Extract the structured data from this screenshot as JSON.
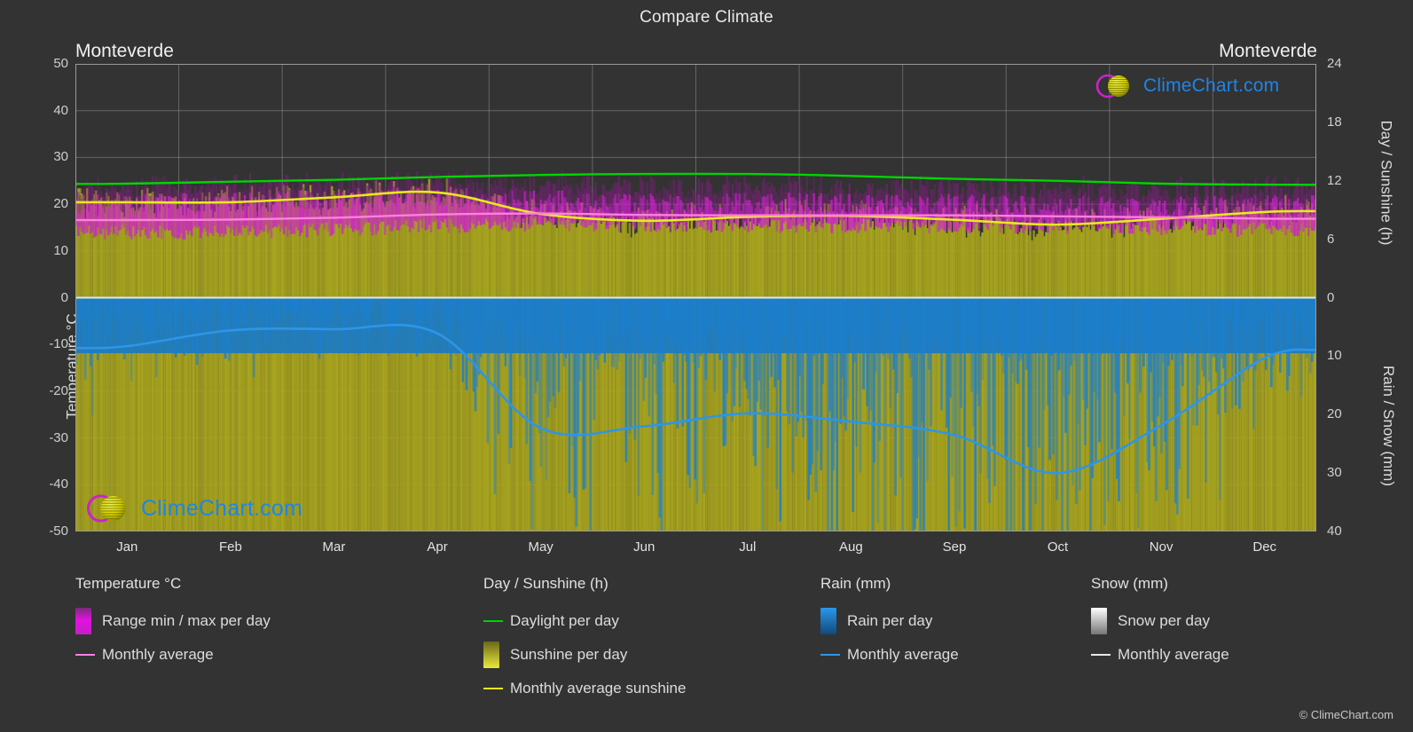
{
  "title": "Compare Climate",
  "location_left": "Monteverde",
  "location_right": "Monteverde",
  "copyright": "© ClimeChart.com",
  "logo": {
    "text": "ClimeChart.com",
    "arc_color": "#cc22cc",
    "sphere_color": "#d4d400",
    "text_color": "#1d86e8"
  },
  "axes": {
    "left_label": "Temperature °C",
    "right_top_label": "Day / Sunshine (h)",
    "right_bottom_label": "Rain / Snow (mm)",
    "left_ticks": [
      "50",
      "40",
      "30",
      "20",
      "10",
      "0",
      "-10",
      "-20",
      "-30",
      "-40",
      "-50"
    ],
    "right_top_ticks": [
      "24",
      "18",
      "12",
      "6",
      "0"
    ],
    "right_bottom_ticks": [
      "0",
      "10",
      "20",
      "30",
      "40"
    ],
    "months": [
      "Jan",
      "Feb",
      "Mar",
      "Apr",
      "May",
      "Jun",
      "Jul",
      "Aug",
      "Sep",
      "Oct",
      "Nov",
      "Dec"
    ]
  },
  "legend": {
    "temperature": {
      "heading": "Temperature °C",
      "items": [
        {
          "label": "Range min / max per day",
          "type": "swatch",
          "color": "#ff00e0"
        },
        {
          "label": "Monthly average",
          "type": "line",
          "color": "#ff7fe0"
        }
      ]
    },
    "sunshine": {
      "heading": "Day / Sunshine (h)",
      "items": [
        {
          "label": "Daylight per day",
          "type": "line",
          "color": "#00d400"
        },
        {
          "label": "Sunshine per day",
          "type": "swatch",
          "color": "#e8e840"
        },
        {
          "label": "Monthly average sunshine",
          "type": "line",
          "color": "#e8e820"
        }
      ]
    },
    "rain": {
      "heading": "Rain (mm)",
      "items": [
        {
          "label": "Rain per day",
          "type": "swatch",
          "color": "#1787e0"
        },
        {
          "label": "Monthly average",
          "type": "line",
          "color": "#2e95e8"
        }
      ]
    },
    "snow": {
      "heading": "Snow (mm)",
      "items": [
        {
          "label": "Snow per day",
          "type": "swatch",
          "color": "#f2f2f2"
        },
        {
          "label": "Monthly average",
          "type": "line",
          "color": "#e8e8e8"
        }
      ]
    }
  },
  "chart_data": {
    "type": "line",
    "title": "Compare Climate",
    "subtitle": "Monteverde",
    "xlabel": "",
    "ylabel": "Temperature °C",
    "y2label_top": "Day / Sunshine (h)",
    "y2label_bottom": "Rain / Snow (mm)",
    "grid": true,
    "legend_position": "bottom",
    "x": [
      "Jan",
      "Feb",
      "Mar",
      "Apr",
      "May",
      "Jun",
      "Jul",
      "Aug",
      "Sep",
      "Oct",
      "Nov",
      "Dec"
    ],
    "ylim_temperature": [
      -50,
      50
    ],
    "ylim_daylight_hours": [
      0,
      24
    ],
    "ylim_rain_mm": [
      0,
      40
    ],
    "series": [
      {
        "name": "Daylight per day",
        "unit": "h",
        "color": "#00d400",
        "axis": "right-top",
        "values": [
          11.7,
          11.9,
          12.1,
          12.4,
          12.6,
          12.7,
          12.7,
          12.5,
          12.2,
          12.0,
          11.7,
          11.6
        ]
      },
      {
        "name": "Monthly average sunshine",
        "unit": "h",
        "color": "#e8e820",
        "axis": "right-top",
        "values": [
          9.8,
          9.8,
          10.3,
          10.8,
          8.6,
          7.9,
          8.3,
          8.4,
          8.0,
          7.5,
          8.1,
          8.8
        ]
      },
      {
        "name": "Temperature monthly average",
        "unit": "°C",
        "color": "#ff7fe0",
        "axis": "left",
        "values": [
          16.6,
          16.7,
          17.1,
          17.8,
          18.0,
          17.7,
          17.6,
          17.6,
          17.6,
          17.4,
          17.2,
          16.9
        ]
      },
      {
        "name": "Temperature range min / max per day",
        "unit": "°C",
        "color": "#ff00e0",
        "axis": "left",
        "min_values": [
          14.0,
          14.0,
          14.5,
          15.4,
          15.8,
          15.6,
          15.4,
          15.4,
          15.4,
          15.2,
          15.0,
          14.5
        ],
        "max_values": [
          20.0,
          20.3,
          21.0,
          21.5,
          20.8,
          20.2,
          20.3,
          20.4,
          20.1,
          19.7,
          19.6,
          19.8
        ]
      },
      {
        "name": "Rain monthly average",
        "unit": "mm",
        "color": "#2e95e8",
        "axis": "right-bottom",
        "values": [
          8.3,
          5.6,
          5.4,
          6.1,
          22.3,
          22.0,
          19.8,
          21.2,
          23.5,
          30.0,
          21.8,
          10.3
        ]
      },
      {
        "name": "Snow monthly average",
        "unit": "mm",
        "color": "#e8e8e8",
        "axis": "right-bottom",
        "values": [
          0,
          0,
          0,
          0,
          0,
          0,
          0,
          0,
          0,
          0,
          0,
          0
        ]
      }
    ]
  }
}
